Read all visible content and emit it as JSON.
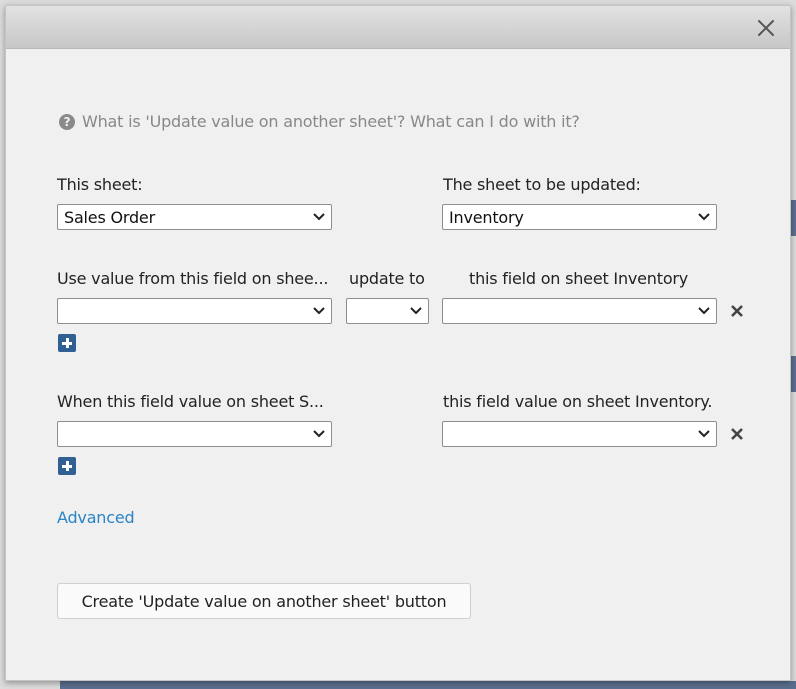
{
  "dialog": {
    "help_text": "What is 'Update value on another sheet'? What can I do with it?",
    "this_sheet_label": "This sheet:",
    "this_sheet_value": "Sales Order",
    "target_sheet_label": "The sheet to be updated:",
    "target_sheet_value": "Inventory",
    "update_section": {
      "source_field_label": "Use value from this field on shee...",
      "operator_label": "update to",
      "target_field_label": "this field on sheet Inventory",
      "source_field_value": "",
      "operator_value": "",
      "target_field_value": ""
    },
    "condition_section": {
      "source_field_label": "When this field value on sheet S...",
      "target_field_label": "this field value on sheet Inventory.",
      "source_field_value": "",
      "target_field_value": ""
    },
    "advanced_link": "Advanced",
    "create_button": "Create 'Update value on another sheet' button"
  },
  "icons": {
    "close": "close-icon",
    "help": "question-circle-icon",
    "remove": "x-icon",
    "add": "plus-square-icon",
    "caret": "chevron-down-icon"
  },
  "colors": {
    "accent_link": "#2a84c6",
    "add_button": "#2f5f93",
    "dialog_bg": "#f0f0f0"
  }
}
